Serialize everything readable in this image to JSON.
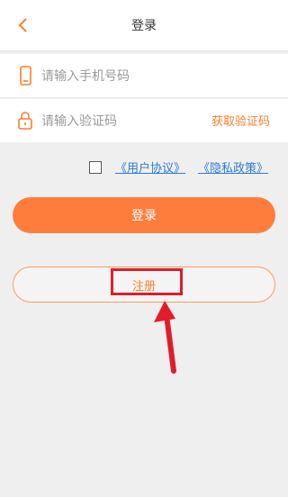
{
  "header": {
    "title": "登录"
  },
  "phone": {
    "placeholder": "请输入手机号码"
  },
  "code": {
    "placeholder": "请输入验证码",
    "get_code_label": "获取验证码"
  },
  "agreement": {
    "user_agreement": "《用户协议》",
    "privacy_policy": "《隐私政策》"
  },
  "buttons": {
    "login": "登录",
    "register": "注册"
  },
  "colors": {
    "accent": "#ff7d3c",
    "link": "#2f7bd6",
    "annotation": "#e11d2a"
  },
  "icons": {
    "back": "chevron-left-icon",
    "phone": "phone-icon",
    "lock": "lock-icon",
    "arrow": "annotation-arrow-icon"
  }
}
